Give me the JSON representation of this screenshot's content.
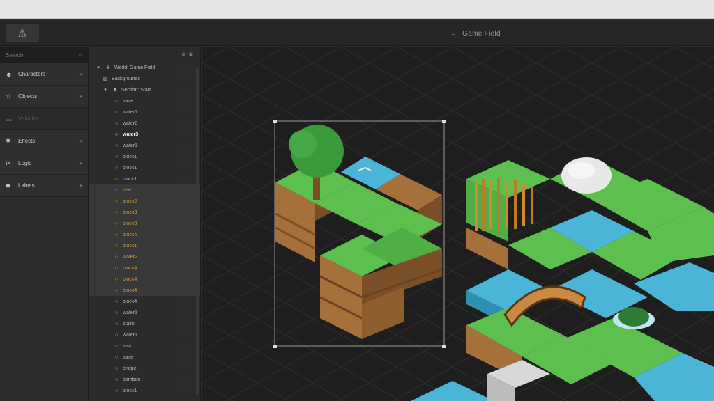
{
  "header": {
    "title": "Game Field",
    "back_icon": "arrow-left-icon",
    "app_icon": "scene-icon"
  },
  "sidebar": {
    "search_placeholder": "Search",
    "categories": [
      {
        "label": "Characters",
        "icon": "person-icon",
        "disabled": false
      },
      {
        "label": "Objects",
        "icon": "star-outline-icon",
        "disabled": false
      },
      {
        "label": "Vehicles",
        "icon": "car-icon",
        "disabled": true
      },
      {
        "label": "Effects",
        "icon": "effects-icon",
        "disabled": false
      },
      {
        "label": "Logic",
        "icon": "logic-icon",
        "disabled": false
      },
      {
        "label": "Labels",
        "icon": "tag-icon",
        "disabled": false
      }
    ]
  },
  "tree": {
    "items": [
      {
        "label": "World: Game Field",
        "indent": 0,
        "icon": "globe-icon",
        "expander": "▾",
        "state": ""
      },
      {
        "label": "Backgrounds",
        "indent": 1,
        "icon": "image-icon",
        "expander": "",
        "state": ""
      },
      {
        "label": "Section: Start",
        "indent": 1,
        "icon": "person-icon",
        "expander": "▾",
        "state": ""
      },
      {
        "label": "tunle",
        "indent": 2,
        "icon": "object-icon",
        "expander": "",
        "state": ""
      },
      {
        "label": "water1",
        "indent": 2,
        "icon": "object-icon",
        "expander": "",
        "state": ""
      },
      {
        "label": "water2",
        "indent": 2,
        "icon": "object-icon",
        "expander": "",
        "state": ""
      },
      {
        "label": "water3",
        "indent": 2,
        "icon": "object-icon",
        "expander": "",
        "state": "bold"
      },
      {
        "label": "water1",
        "indent": 2,
        "icon": "object-icon",
        "expander": "",
        "state": ""
      },
      {
        "label": "block1",
        "indent": 2,
        "icon": "object-icon",
        "expander": "",
        "state": ""
      },
      {
        "label": "block1",
        "indent": 2,
        "icon": "object-icon",
        "expander": "",
        "state": ""
      },
      {
        "label": "block1",
        "indent": 2,
        "icon": "object-icon",
        "expander": "",
        "state": ""
      },
      {
        "label": "tree",
        "indent": 2,
        "icon": "object-icon",
        "expander": "",
        "state": "sel"
      },
      {
        "label": "block2",
        "indent": 2,
        "icon": "object-icon",
        "expander": "",
        "state": "sel"
      },
      {
        "label": "block3",
        "indent": 2,
        "icon": "object-icon",
        "expander": "",
        "state": "sel"
      },
      {
        "label": "block3",
        "indent": 2,
        "icon": "object-icon",
        "expander": "",
        "state": "sel"
      },
      {
        "label": "block4",
        "indent": 2,
        "icon": "object-icon",
        "expander": "",
        "state": "sel"
      },
      {
        "label": "block1",
        "indent": 2,
        "icon": "object-icon",
        "expander": "",
        "state": "sel"
      },
      {
        "label": "water2",
        "indent": 2,
        "icon": "object-icon",
        "expander": "",
        "state": "sel"
      },
      {
        "label": "block4",
        "indent": 2,
        "icon": "object-icon",
        "expander": "",
        "state": "sel"
      },
      {
        "label": "block4",
        "indent": 2,
        "icon": "object-icon",
        "expander": "",
        "state": "sel"
      },
      {
        "label": "block4",
        "indent": 2,
        "icon": "object-icon",
        "expander": "",
        "state": "sel"
      },
      {
        "label": "block4",
        "indent": 2,
        "icon": "object-icon",
        "expander": "",
        "state": ""
      },
      {
        "label": "water1",
        "indent": 2,
        "icon": "object-icon",
        "expander": "",
        "state": ""
      },
      {
        "label": "stairs",
        "indent": 2,
        "icon": "object-icon",
        "expander": "",
        "state": ""
      },
      {
        "label": "water1",
        "indent": 2,
        "icon": "object-icon",
        "expander": "",
        "state": ""
      },
      {
        "label": "tusk",
        "indent": 2,
        "icon": "object-icon",
        "expander": "",
        "state": ""
      },
      {
        "label": "tunle",
        "indent": 2,
        "icon": "object-icon",
        "expander": "",
        "state": ""
      },
      {
        "label": "bridge",
        "indent": 2,
        "icon": "object-icon",
        "expander": "",
        "state": ""
      },
      {
        "label": "bamboo",
        "indent": 2,
        "icon": "object-icon",
        "expander": "",
        "state": ""
      },
      {
        "label": "block1",
        "indent": 2,
        "icon": "object-icon",
        "expander": "",
        "state": ""
      }
    ],
    "row_actions": "◦ ◦"
  },
  "colors": {
    "grass": "#5cbf4e",
    "grass_dark": "#3f9a3a",
    "dirt": "#a5703a",
    "dirt_dark": "#7a4e26",
    "water": "#4ab5d6",
    "water_dark": "#2f8fb0",
    "selection_text": "#d8a43a"
  }
}
